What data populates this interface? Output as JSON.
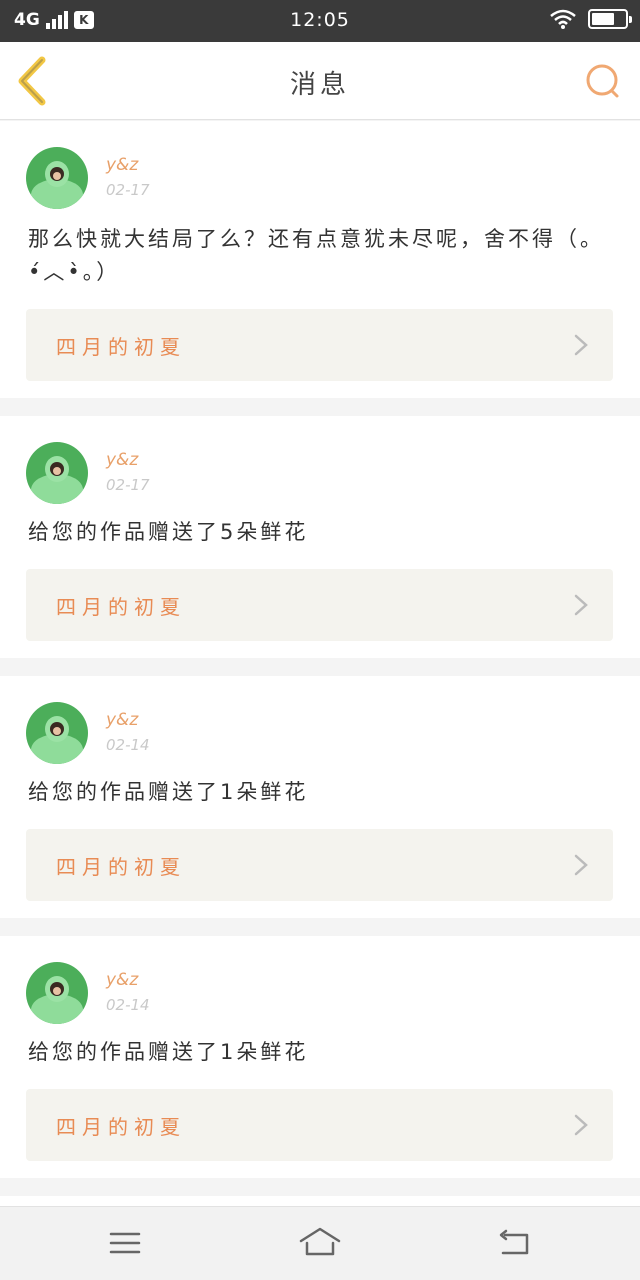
{
  "status_bar": {
    "network": "4G",
    "carrier_badge": "K",
    "time": "12:05",
    "icons": [
      "signal-icon",
      "wifi-icon",
      "battery-icon"
    ]
  },
  "header": {
    "title": "消息",
    "back_icon": "chevron-left-icon",
    "search_icon": "search-icon"
  },
  "messages": [
    {
      "user": "y&z",
      "date": "02-17",
      "text": "那么快就大结局了么？还有点意犹未尽呢，舍不得（。•́︿•̀。）",
      "work_title": "四月的初夏"
    },
    {
      "user": "y&z",
      "date": "02-17",
      "text": "给您的作品赠送了5朵鲜花",
      "work_title": "四月的初夏"
    },
    {
      "user": "y&z",
      "date": "02-14",
      "text": "给您的作品赠送了1朵鲜花",
      "work_title": "四月的初夏"
    },
    {
      "user": "y&z",
      "date": "02-14",
      "text": "给您的作品赠送了1朵鲜花",
      "work_title": "四月的初夏"
    }
  ],
  "bottom_nav": {
    "icons": [
      "menu-icon",
      "home-icon",
      "back-icon"
    ]
  },
  "colors": {
    "accent": "#e8a069",
    "work_title": "#e88b54",
    "back_arrow": "#f2c744",
    "search": "#f0a872"
  }
}
